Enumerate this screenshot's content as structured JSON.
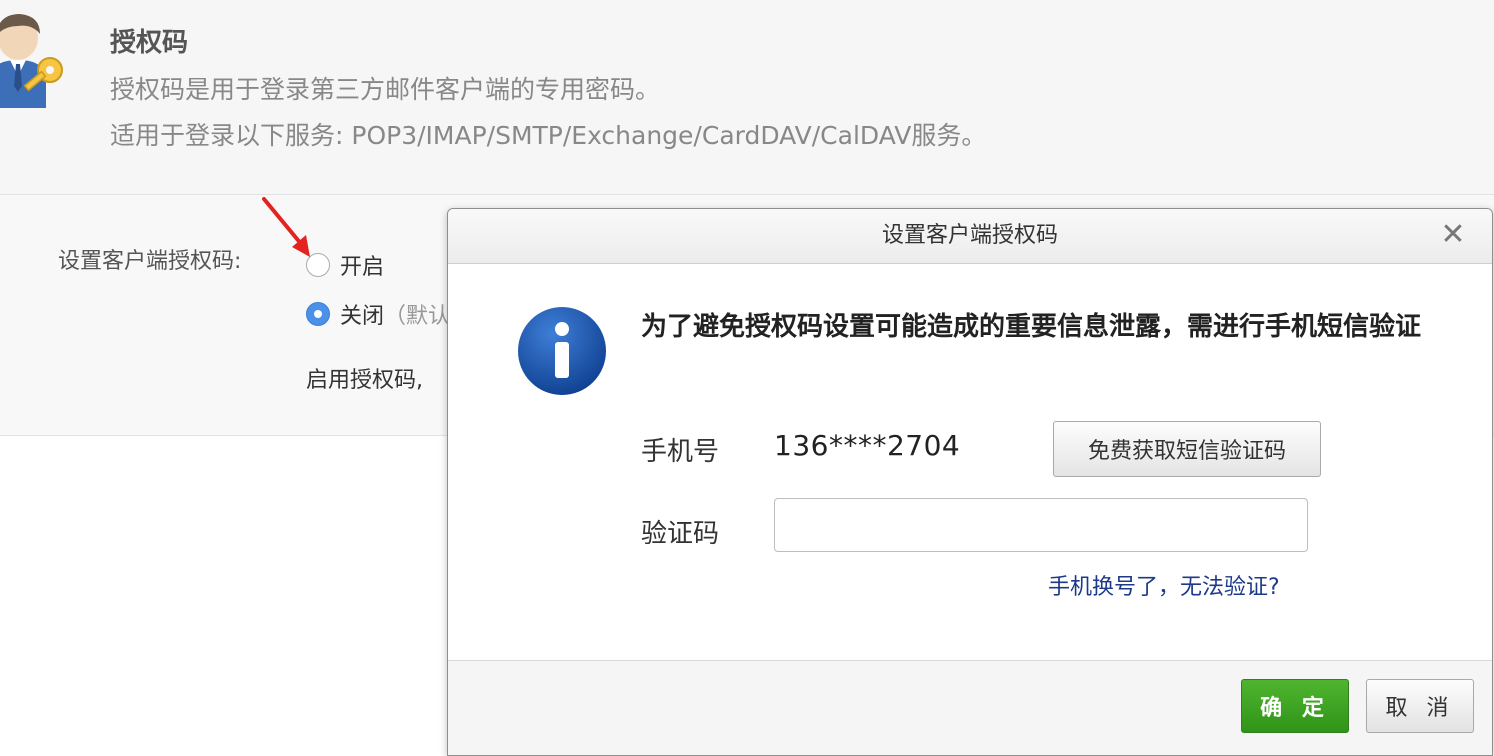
{
  "header": {
    "title": "授权码",
    "description_line1": "授权码是用于登录第三方邮件客户端的专用密码。",
    "description_line2": "适用于登录以下服务: POP3/IMAP/SMTP/Exchange/CardDAV/CalDAV服务。"
  },
  "settings": {
    "label": "设置客户端授权码:",
    "option_on": "开启",
    "option_off": "关闭",
    "option_off_hint": "（默认",
    "selected": "off",
    "enable_text": "启用授权码,"
  },
  "dialog": {
    "title": "设置客户端授权码",
    "close_symbol": "✕",
    "message": "为了避免授权码设置可能造成的重要信息泄露，需进行手机短信验证",
    "phone_label": "手机号",
    "phone_value": "136****2704",
    "sms_button": "免费获取短信验证码",
    "code_label": "验证码",
    "code_value": "",
    "help_link": "手机换号了，无法验证?",
    "ok_button": "确 定",
    "cancel_button": "取 消"
  },
  "colors": {
    "accent_blue": "#4b91e8",
    "ok_green": "#2f9418",
    "link_blue": "#1d3a8a",
    "annotation_red": "#e3231f"
  },
  "icons": [
    "user-key-avatar-icon",
    "red-arrow-icon",
    "info-icon",
    "close-icon"
  ]
}
